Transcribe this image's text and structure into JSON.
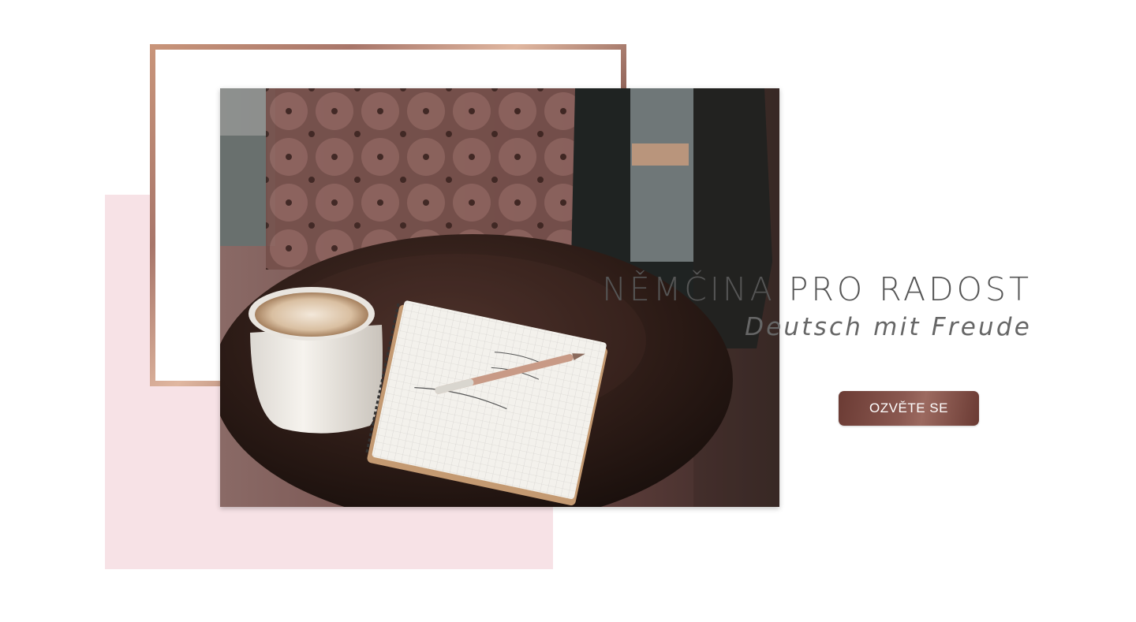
{
  "hero": {
    "title": "NĚMČINA PRO RADOST",
    "subtitle": "Deutsch mit Freude",
    "cta_label": "OZVĚTE SE",
    "photo_alt": "Káva a zápisník na stole"
  },
  "colors": {
    "pink_block": "#f7e2e6",
    "frame_gradient": [
      "#c9957a",
      "#a8766a",
      "#e0b7a0",
      "#8d5f55"
    ],
    "cta_gradient": [
      "#6b3b34",
      "#9c6a60"
    ],
    "title_text": "#555555"
  }
}
